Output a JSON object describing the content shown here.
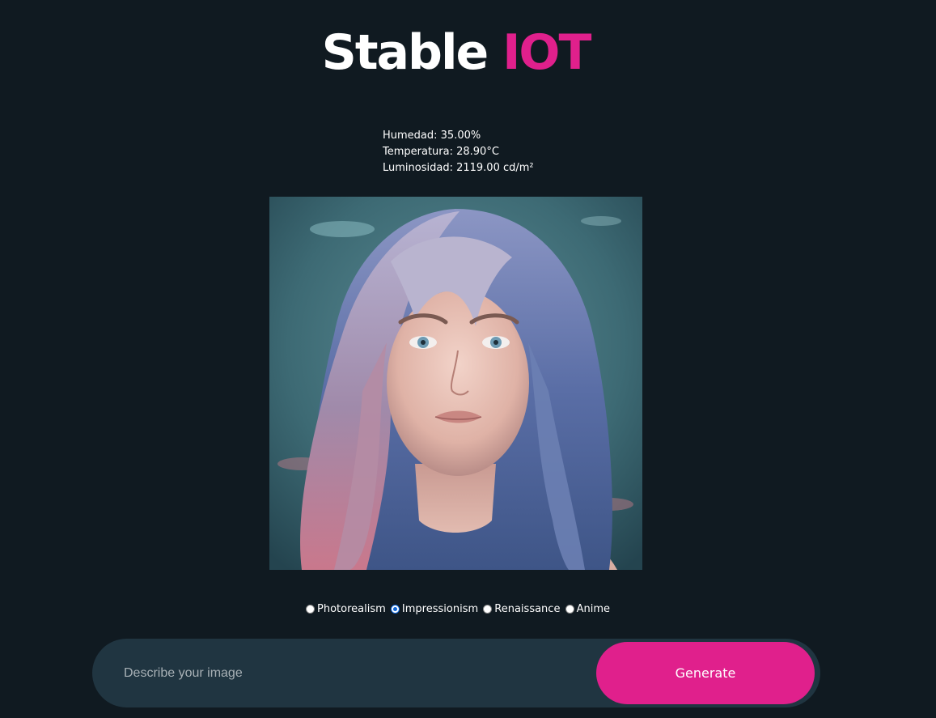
{
  "header": {
    "title_main": "Stable",
    "title_accent": "IOT",
    "accent_color": "#e0208c"
  },
  "sensors": {
    "humidity": "Humedad: 35.00%",
    "temperature": "Temperatura: 28.90°C",
    "luminosity": "Luminosidad: 2119.00 cd/m²"
  },
  "styles": {
    "options": [
      "Photorealism",
      "Impressionism",
      "Renaissance",
      "Anime"
    ],
    "selected": "Impressionism"
  },
  "prompt": {
    "placeholder": "Describe your image",
    "value": "",
    "button_label": "Generate"
  },
  "colors": {
    "background": "#101a21",
    "input_bar": "#203541",
    "accent": "#e0208c"
  }
}
